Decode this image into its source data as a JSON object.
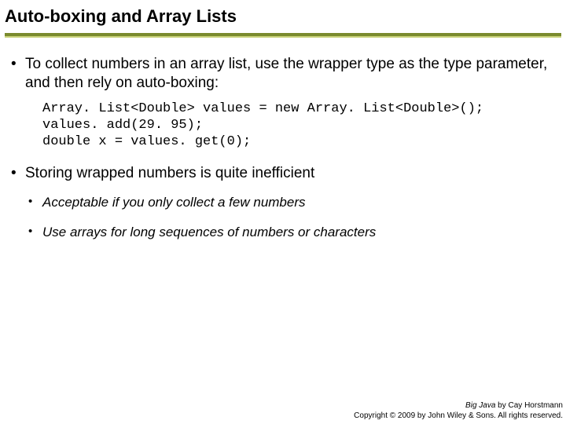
{
  "title": "Auto-boxing and Array Lists",
  "bullets": {
    "b1": "To collect numbers in an array list, use the wrapper type as the type parameter, and then rely on auto-boxing:",
    "code": "Array. List<Double> values = new Array. List<Double>();\nvalues. add(29. 95);\ndouble x = values. get(0);",
    "b2": "Storing wrapped numbers is quite inefficient",
    "b2_sub1": "Acceptable if you only collect a few numbers",
    "b2_sub2": "Use arrays for long sequences of numbers or characters"
  },
  "footer": {
    "line1_book": "Big Java",
    "line1_rest": " by Cay Horstmann",
    "line2": "Copyright © 2009 by John Wiley & Sons. All rights reserved."
  }
}
